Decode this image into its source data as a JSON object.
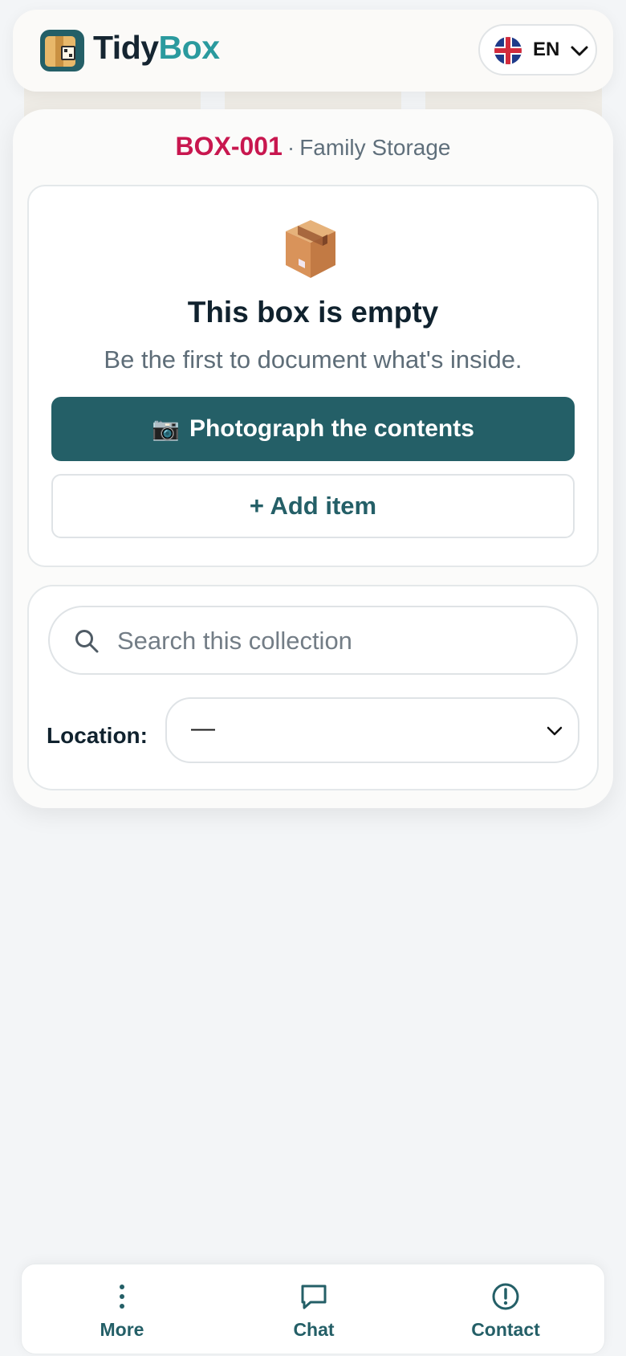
{
  "header": {
    "brand_part1": "Tidy",
    "brand_part2": "Box",
    "language": {
      "code": "EN",
      "flag_icon": "uk-flag-icon"
    }
  },
  "box": {
    "id": "BOX-001",
    "separator": "·",
    "collection": "Family Storage"
  },
  "empty_state": {
    "icon": "package-icon",
    "title": "This box is empty",
    "subtitle": "Be the first to document what's inside.",
    "photo_icon": "📷",
    "photo_button": "Photograph the contents",
    "add_button": "+ Add item"
  },
  "filters": {
    "search_placeholder": "Search this collection",
    "location_label": "Location:",
    "location_value": "—"
  },
  "bottom_nav": {
    "items": [
      {
        "label": "More",
        "icon": "more-vertical-icon"
      },
      {
        "label": "Chat",
        "icon": "chat-icon"
      },
      {
        "label": "Contact",
        "icon": "alert-circle-icon"
      }
    ]
  },
  "colors": {
    "primary": "#245f67",
    "accent": "#c8174f",
    "brand_teal": "#2a9a9e",
    "background": "#f3f5f7"
  }
}
